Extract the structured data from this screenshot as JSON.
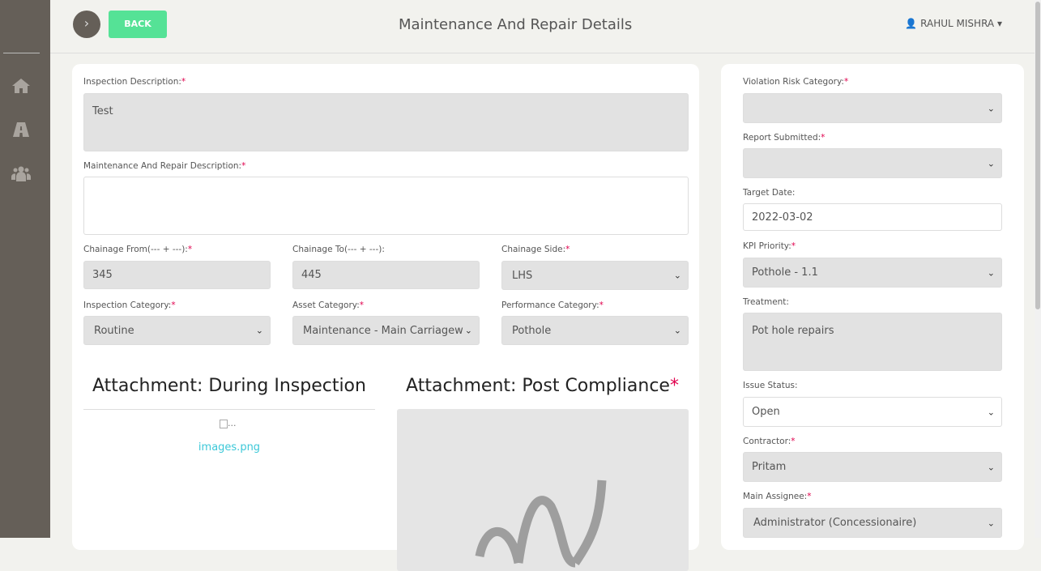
{
  "header": {
    "title": "Maintenance And Repair Details",
    "back_label": "BACK",
    "user_name": "RAHUL MISHRA"
  },
  "sidebar": {
    "items": [
      {
        "icon": "home-icon"
      },
      {
        "icon": "road-icon"
      },
      {
        "icon": "users-icon"
      }
    ]
  },
  "form": {
    "inspection_description": {
      "label": "Inspection Description:",
      "value": "Test"
    },
    "repair_description": {
      "label": "Maintenance And Repair Description:",
      "value": ""
    },
    "chainage_from": {
      "label": "Chainage From(--- + ---):",
      "value": "345"
    },
    "chainage_to": {
      "label": "Chainage To(--- + ---):",
      "value": "445"
    },
    "chainage_side": {
      "label": "Chainage Side:",
      "value": "LHS"
    },
    "inspection_category": {
      "label": "Inspection Category:",
      "value": "Routine"
    },
    "asset_category": {
      "label": "Asset Category:",
      "value": "Maintenance - Main Carriagew"
    },
    "performance_category": {
      "label": "Performance Category:",
      "value": "Pothole"
    }
  },
  "attachments": {
    "during_title": "Attachment: During Inspection",
    "during_file": "images.png",
    "broken_alt": "...",
    "post_title": "Attachment: Post Compliance"
  },
  "side": {
    "violation_risk": {
      "label": "Violation Risk Category:",
      "value": ""
    },
    "report_submitted": {
      "label": "Report Submitted:",
      "value": ""
    },
    "target_date": {
      "label": "Target Date:",
      "value": "2022-03-02"
    },
    "kpi_priority": {
      "label": "KPI Priority:",
      "value": "Pothole - 1.1"
    },
    "treatment": {
      "label": "Treatment:",
      "value": "Pot hole repairs"
    },
    "issue_status": {
      "label": "Issue Status:",
      "value": "Open"
    },
    "contractor": {
      "label": "Contractor:",
      "value": "Pritam"
    },
    "main_assignee": {
      "label": "Main Assignee:",
      "value": "Administrator (Concessionaire)"
    }
  },
  "required_mark": "*",
  "colors": {
    "sidebar": "#655f58",
    "back": "#55e296",
    "required": "#e0004d",
    "link": "#3cc8d8"
  }
}
